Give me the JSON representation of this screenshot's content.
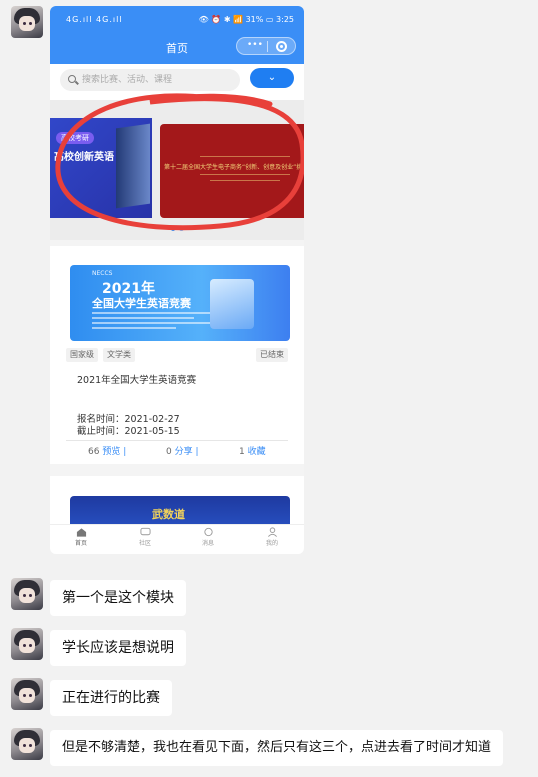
{
  "phone": {
    "status": {
      "signal": "4G.ıll 4G.ıll",
      "icons": "👁 ⏰ ✱ 📶",
      "battery": "31%",
      "time": "3:25"
    },
    "nav": {
      "title": "首页",
      "capsule_dots": "•••"
    },
    "search": {
      "placeholder": "搜索比赛、活动、课程"
    },
    "banner": {
      "slide1_tag": "高校考研",
      "slide1_title": "高校创新英语",
      "slide2_title": "第十二届全国大学生电子商务“创新、创意及创业”挑战赛"
    },
    "card1": {
      "poster_small": "NECCS",
      "poster_year": "2021年",
      "poster_title": "全国大学生英语竞赛",
      "tags": [
        "国家级",
        "文学类"
      ],
      "status": "已结束",
      "title": "2021年全国大学生英语竞赛",
      "signup_label": "报名时间：",
      "signup_value": "2021-02-27",
      "deadline_label": "截止时间：",
      "deadline_value": "2021-05-15",
      "views": "66",
      "views_label": "预览 |",
      "shares": "0",
      "shares_label": "分享 |",
      "favs": "1",
      "favs_label": "收藏"
    },
    "card2": {
      "poster_title": "武数道"
    },
    "tabs": [
      "首页",
      "社区",
      "消息",
      "我的"
    ]
  },
  "messages": [
    "第一个是这个模块",
    "学长应该是想说明",
    "正在进行的比赛",
    "但是不够清楚，我也在看见下面，然后只有这三个，点进去看了时间才知道"
  ],
  "colors": {
    "accent": "#3a8ef6",
    "annotation": "#e8403a",
    "chat_bg": "#f2f2f2"
  }
}
